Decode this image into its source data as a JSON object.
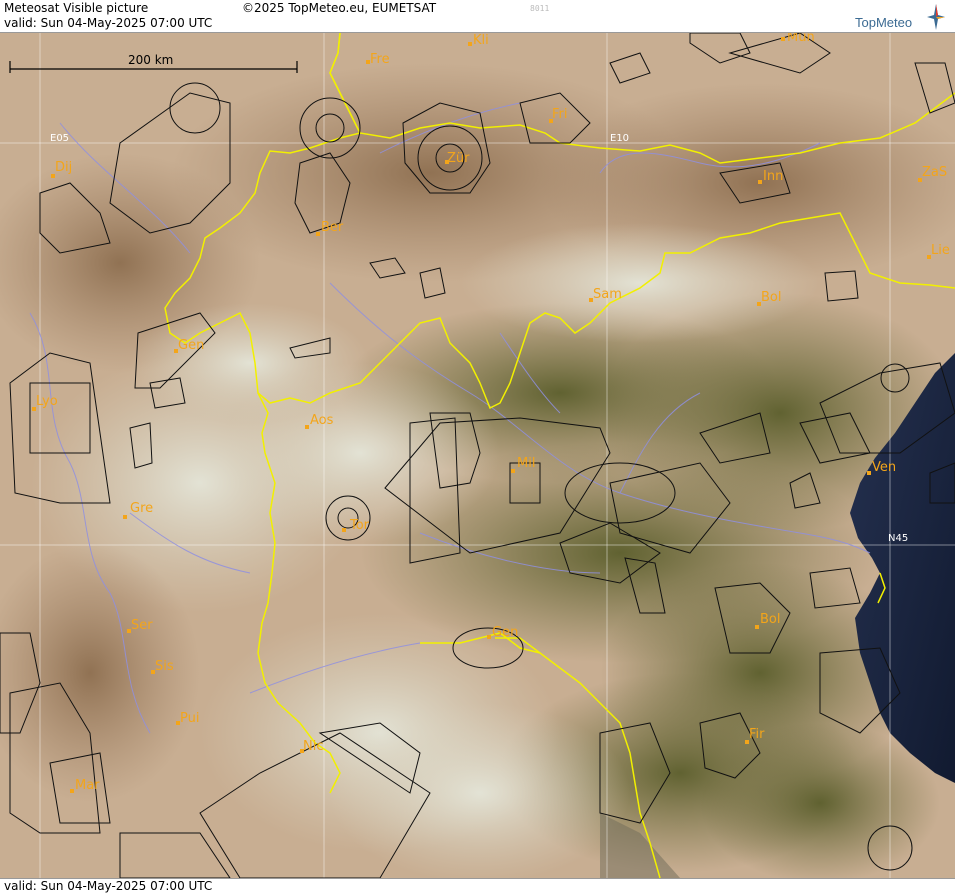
{
  "header": {
    "title": "Meteosat Visible picture",
    "valid": "valid:  Sun  04-May-2025  07:00 UTC",
    "copyright": "©2025 TopMeteo.eu, EUMETSAT",
    "code": "8011",
    "logo_text": "TopMeteo"
  },
  "footer": {
    "valid": "valid:  Sun  04-May-2025  07:00 UTC"
  },
  "scale": {
    "label": "200 km"
  },
  "grid_labels": {
    "e05": "E05",
    "e10": "E10",
    "n45": "N45"
  },
  "cities": [
    {
      "id": "kli",
      "name": "Kli"
    },
    {
      "id": "mun",
      "name": "Mun"
    },
    {
      "id": "fre",
      "name": "Fre"
    },
    {
      "id": "fri",
      "name": "Fri"
    },
    {
      "id": "zur",
      "name": "Zür"
    },
    {
      "id": "dij",
      "name": "Dij"
    },
    {
      "id": "inn",
      "name": "Inn"
    },
    {
      "id": "zas",
      "name": "ZaS"
    },
    {
      "id": "ber",
      "name": "Ber"
    },
    {
      "id": "lie",
      "name": "Lie"
    },
    {
      "id": "sam",
      "name": "Sam"
    },
    {
      "id": "bol1",
      "name": "Bol"
    },
    {
      "id": "gen1",
      "name": "Gen"
    },
    {
      "id": "lyo",
      "name": "Lyo"
    },
    {
      "id": "aos",
      "name": "Aos"
    },
    {
      "id": "mil",
      "name": "Mil"
    },
    {
      "id": "ven",
      "name": "Ven"
    },
    {
      "id": "gre",
      "name": "Gre"
    },
    {
      "id": "tor",
      "name": "Tor"
    },
    {
      "id": "ser",
      "name": "Ser"
    },
    {
      "id": "gen2",
      "name": "Gen"
    },
    {
      "id": "bol2",
      "name": "Bol"
    },
    {
      "id": "sis",
      "name": "Sis"
    },
    {
      "id": "pui",
      "name": "Pui"
    },
    {
      "id": "nic",
      "name": "Nic"
    },
    {
      "id": "fir",
      "name": "Fir"
    },
    {
      "id": "mar",
      "name": "Mar"
    }
  ],
  "colors": {
    "border": "#f2f000",
    "city_label": "#f3a51a",
    "airspace": "#111111",
    "rivers": "#8f8fe0",
    "sea": "#1a2540"
  }
}
